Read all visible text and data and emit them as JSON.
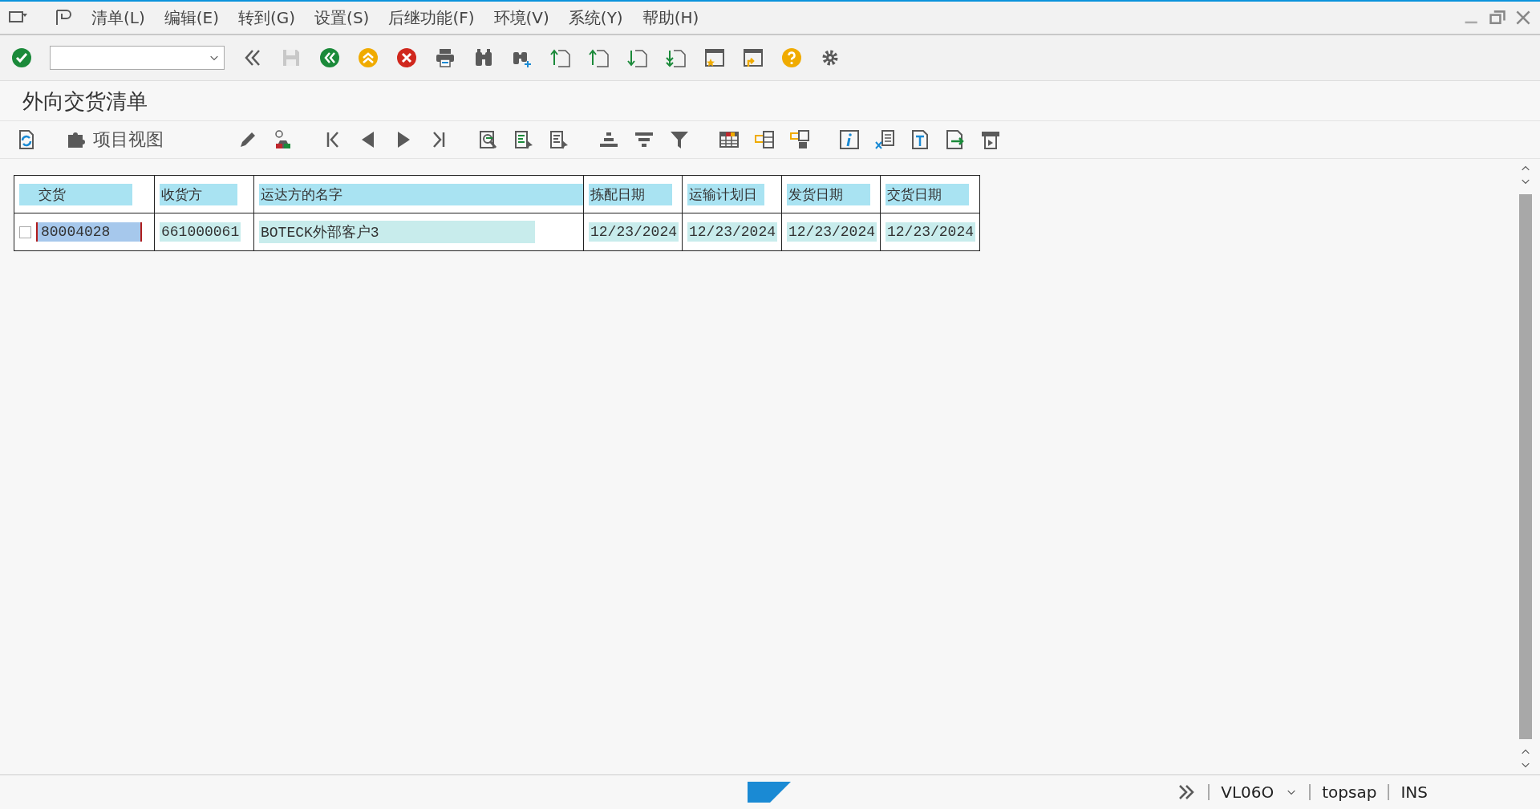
{
  "menu_bar": {
    "items": [
      {
        "label": "清单(L)"
      },
      {
        "label": "编辑(E)"
      },
      {
        "label": "转到(G)"
      },
      {
        "label": "设置(S)"
      },
      {
        "label": "后继功能(F)"
      },
      {
        "label": "环境(V)"
      },
      {
        "label": "系统(Y)"
      },
      {
        "label": "帮助(H)"
      }
    ]
  },
  "screen_title": "外向交货清单",
  "app_toolbar": {
    "item_view_button": "项目视图"
  },
  "table": {
    "columns": [
      "交货",
      "收货方",
      "运达方的名字",
      "拣配日期",
      "运输计划日",
      "发货日期",
      "交货日期"
    ],
    "rows": [
      {
        "checked": false,
        "focused": true,
        "cells": [
          "80004028",
          "661000061",
          "BOTECK外部客户3",
          "12/23/2024",
          "12/23/2024",
          "12/23/2024",
          "12/23/2024"
        ]
      }
    ]
  },
  "status_bar": {
    "transaction": "VL06O",
    "user": "topsap",
    "mode": "INS"
  }
}
